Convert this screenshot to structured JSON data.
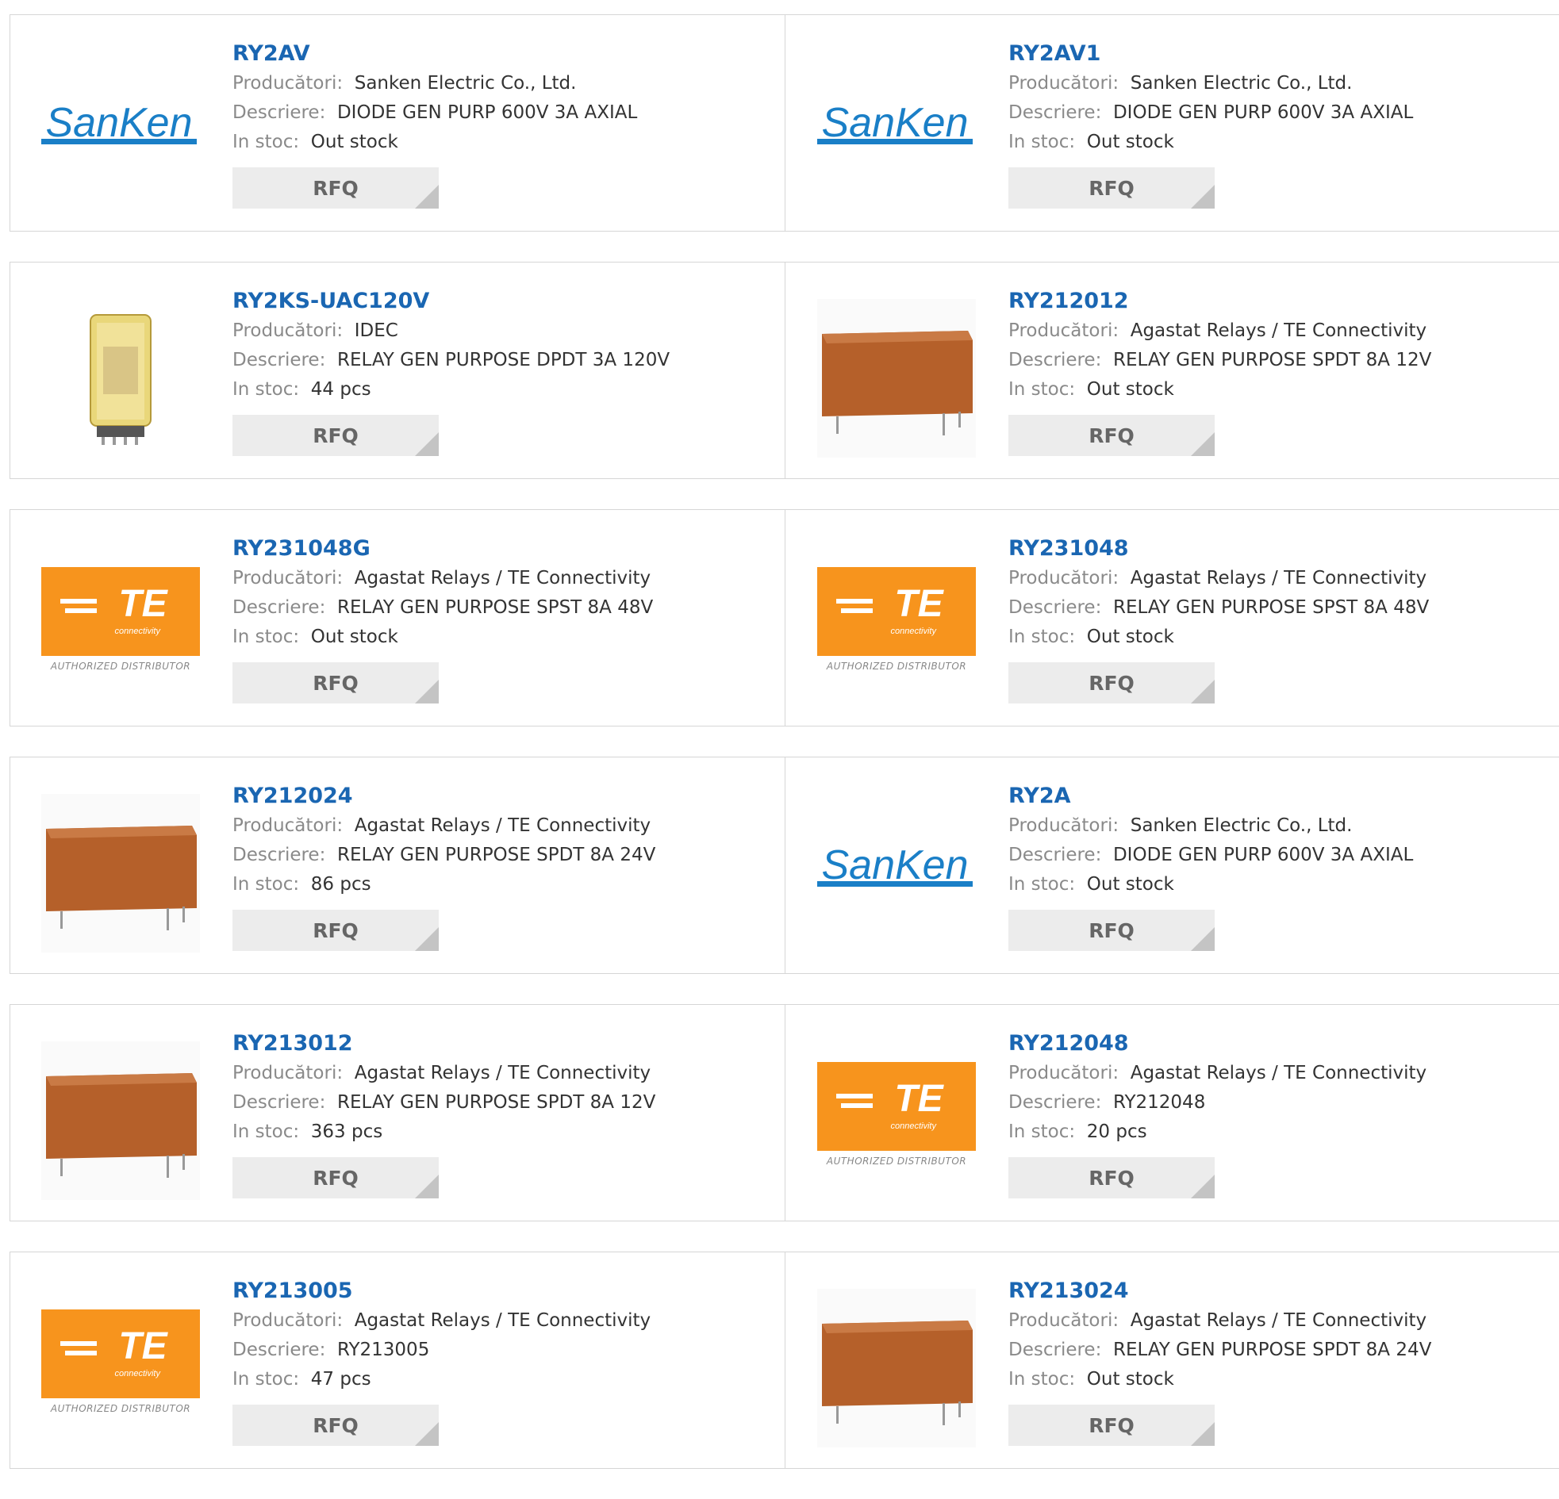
{
  "labels": {
    "manufacturer": "Producători:",
    "description": "Descriere:",
    "stock": "In stoc:",
    "rfq": "RFQ"
  },
  "logos": {
    "sanken": "SanKen",
    "te_main": "TE",
    "te_sub": "connectivity",
    "te_footer": "AUTHORIZED DISTRIBUTOR"
  },
  "colors": {
    "link": "#1a66b2",
    "te_orange": "#f7941d",
    "sanken_blue": "#1a7fc7",
    "relay_brown": "#b5602a"
  },
  "products": [
    {
      "pn": "RY2AV",
      "manufacturer": "Sanken Electric Co., Ltd.",
      "description": "DIODE GEN PURP 600V 3A AXIAL",
      "stock": "Out stock",
      "image": "sanken-logo"
    },
    {
      "pn": "RY2AV1",
      "manufacturer": "Sanken Electric Co., Ltd.",
      "description": "DIODE GEN PURP 600V 3A AXIAL",
      "stock": "Out stock",
      "image": "sanken-logo"
    },
    {
      "pn": "RY2KS-UAC120V",
      "manufacturer": "IDEC",
      "description": "RELAY GEN PURPOSE DPDT 3A 120V",
      "stock": "44 pcs",
      "image": "idec-relay-photo"
    },
    {
      "pn": "RY212012",
      "manufacturer": "Agastat Relays / TE Connectivity",
      "description": "RELAY GEN PURPOSE SPDT 8A 12V",
      "stock": "Out stock",
      "image": "pcb-relay-photo"
    },
    {
      "pn": "RY231048G",
      "manufacturer": "Agastat Relays / TE Connectivity",
      "description": "RELAY GEN PURPOSE SPST 8A 48V",
      "stock": "Out stock",
      "image": "te-logo"
    },
    {
      "pn": "RY231048",
      "manufacturer": "Agastat Relays / TE Connectivity",
      "description": "RELAY GEN PURPOSE SPST 8A 48V",
      "stock": "Out stock",
      "image": "te-logo"
    },
    {
      "pn": "RY212024",
      "manufacturer": "Agastat Relays / TE Connectivity",
      "description": "RELAY GEN PURPOSE SPDT 8A 24V",
      "stock": "86 pcs",
      "image": "pcb-relay-photo"
    },
    {
      "pn": "RY2A",
      "manufacturer": "Sanken Electric Co., Ltd.",
      "description": "DIODE GEN PURP 600V 3A AXIAL",
      "stock": "Out stock",
      "image": "sanken-logo"
    },
    {
      "pn": "RY213012",
      "manufacturer": "Agastat Relays / TE Connectivity",
      "description": "RELAY GEN PURPOSE SPDT 8A 12V",
      "stock": "363 pcs",
      "image": "pcb-relay-photo"
    },
    {
      "pn": "RY212048",
      "manufacturer": "Agastat Relays / TE Connectivity",
      "description": "RY212048",
      "stock": "20 pcs",
      "image": "te-logo"
    },
    {
      "pn": "RY213005",
      "manufacturer": "Agastat Relays / TE Connectivity",
      "description": "RY213005",
      "stock": "47 pcs",
      "image": "te-logo"
    },
    {
      "pn": "RY213024",
      "manufacturer": "Agastat Relays / TE Connectivity",
      "description": "RELAY GEN PURPOSE SPDT 8A 24V",
      "stock": "Out stock",
      "image": "pcb-relay-photo"
    }
  ]
}
